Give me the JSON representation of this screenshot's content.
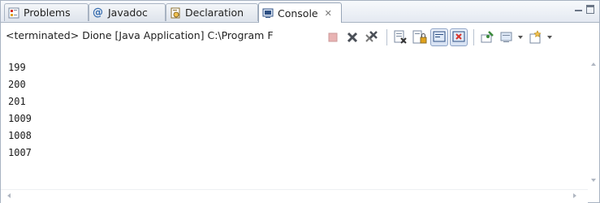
{
  "tabs": [
    {
      "label": "Problems",
      "icon": "problems-icon"
    },
    {
      "label": "Javadoc",
      "icon": "javadoc-icon"
    },
    {
      "label": "Declaration",
      "icon": "declaration-icon"
    },
    {
      "label": "Console",
      "icon": "console-icon",
      "active": true,
      "close": "✕"
    }
  ],
  "status": "<terminated> Dione [Java Application] C:\\Program F",
  "toolbar": {
    "buttons": [
      "terminate-icon",
      "remove-launch-icon",
      "remove-all-terminated-icon",
      "clear-console-icon",
      "scroll-lock-icon",
      "word-wrap-icon",
      "show-on-output-icon",
      "show-on-error-icon",
      "pin-console-icon",
      "display-selected-console-icon",
      "open-console-icon"
    ]
  },
  "console": {
    "lines": [
      "199",
      "200",
      "201",
      "1009",
      "1008",
      "1007"
    ]
  },
  "colors": {
    "border": "#a8b3c2",
    "accent": "#3a6fb0"
  }
}
